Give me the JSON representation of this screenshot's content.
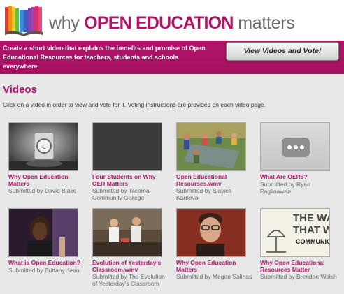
{
  "header": {
    "title_why": "why",
    "title_open": "OPEN EDUCATION",
    "title_matters": "matters",
    "tagline": "Create a short video that explains the benefits and promise of Open Educational Resources for teachers, students and schools everywhere.",
    "cta_label": "View Videos and Vote!"
  },
  "videos_section": {
    "title": "Videos",
    "instructions": "Click on a video in order to view and vote for it. Voting instructions are provided on each video page."
  },
  "videos": [
    {
      "title": "Why Open Education Matters",
      "submitted": "Submitted by David Blake"
    },
    {
      "title": "Four Students on Why OER Matters",
      "submitted": "Submitted by Tacoma Community College"
    },
    {
      "title": "Open Educational Resourses.wmv",
      "submitted": "Submitted by Slavica Karbeva"
    },
    {
      "title": "What Are OERs?",
      "submitted": "Submitted by Ryan Paglinawan"
    },
    {
      "title": "What is Open Education?",
      "submitted": "Submitted by Brittany Jean"
    },
    {
      "title": "Evolution of Yesterday's Classroom.wmv",
      "submitted": "Submitted by The Evolution of Yesterday's Classroom"
    },
    {
      "title": "Why Open Education Matters",
      "submitted": "Submitted by Megan Salinas"
    },
    {
      "title": "Why Open Educational Resources Matter",
      "submitted": "Submitted by Brendan Walsh"
    }
  ],
  "thumb_texts": {
    "video8": [
      "THE WA",
      "THAT W",
      "COMMUNICA"
    ]
  },
  "colors": {
    "brand": "#b01466",
    "header_bg": "#c21b78",
    "page_bg": "#e8e8e8"
  }
}
